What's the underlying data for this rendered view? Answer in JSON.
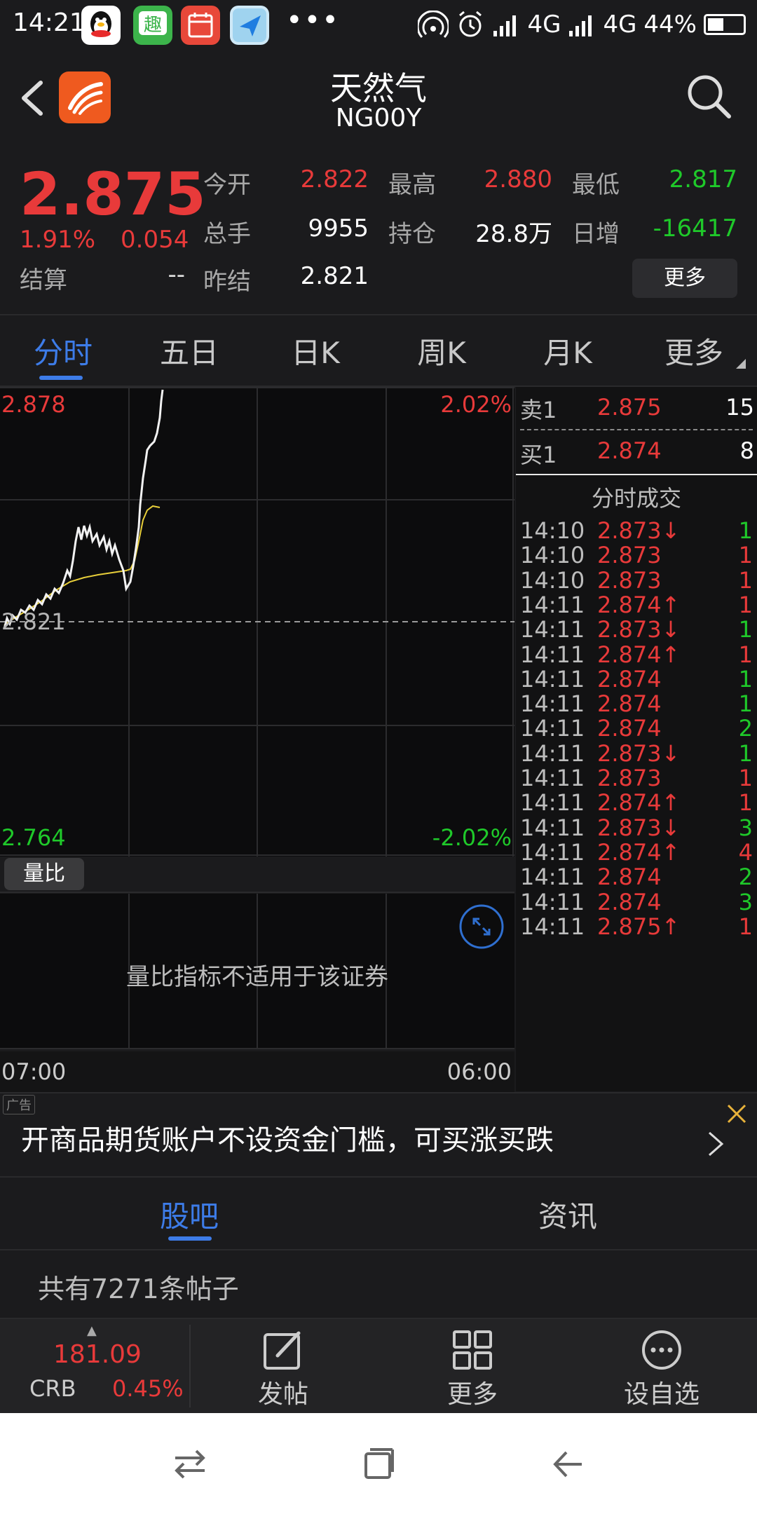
{
  "status": {
    "time": "14:21",
    "network1": "4G",
    "network2": "4G",
    "battery": "44%"
  },
  "header": {
    "title": "天然气",
    "code": "NG00Y"
  },
  "quote": {
    "price": "2.875",
    "pct": "1.91%",
    "change": "0.054",
    "settle_label": "结算",
    "settle_value": "--",
    "open_label": "今开",
    "open_value": "2.822",
    "high_label": "最高",
    "high_value": "2.880",
    "low_label": "最低",
    "low_value": "2.817",
    "volume_label": "总手",
    "volume_value": "9955",
    "oi_label": "持仓",
    "oi_value": "28.8万",
    "daily_inc_label": "日增",
    "daily_inc_value": "-16417",
    "prev_settle_label": "昨结",
    "prev_settle_value": "2.821",
    "more_label": "更多"
  },
  "tabs": [
    "分时",
    "五日",
    "日K",
    "周K",
    "月K",
    "更多"
  ],
  "chart": {
    "top_price": "2.878",
    "top_pct": "2.02%",
    "bottom_price": "2.764",
    "bottom_pct": "-2.02%",
    "ref_price": "2.821",
    "start_time": "07:00",
    "end_time": "06:00",
    "volratio_label": "量比",
    "volratio_msg": "量比指标不适用于该证券"
  },
  "book": {
    "sell_label": "卖1",
    "sell_price": "2.875",
    "sell_qty": "15",
    "buy_label": "买1",
    "buy_price": "2.874",
    "buy_qty": "8",
    "trades_title": "分时成交",
    "trades": [
      {
        "time": "14:10",
        "price": "2.873↓",
        "qty": "1",
        "dir": "down"
      },
      {
        "time": "14:10",
        "price": "2.873",
        "qty": "1",
        "dir": "up"
      },
      {
        "time": "14:10",
        "price": "2.873",
        "qty": "1",
        "dir": "up"
      },
      {
        "time": "14:11",
        "price": "2.874↑",
        "qty": "1",
        "dir": "up"
      },
      {
        "time": "14:11",
        "price": "2.873↓",
        "qty": "1",
        "dir": "down"
      },
      {
        "time": "14:11",
        "price": "2.874↑",
        "qty": "1",
        "dir": "up"
      },
      {
        "time": "14:11",
        "price": "2.874",
        "qty": "1",
        "dir": "down"
      },
      {
        "time": "14:11",
        "price": "2.874",
        "qty": "1",
        "dir": "down"
      },
      {
        "time": "14:11",
        "price": "2.874",
        "qty": "2",
        "dir": "down"
      },
      {
        "time": "14:11",
        "price": "2.873↓",
        "qty": "1",
        "dir": "down"
      },
      {
        "time": "14:11",
        "price": "2.873",
        "qty": "1",
        "dir": "up"
      },
      {
        "time": "14:11",
        "price": "2.874↑",
        "qty": "1",
        "dir": "up"
      },
      {
        "time": "14:11",
        "price": "2.873↓",
        "qty": "3",
        "dir": "down"
      },
      {
        "time": "14:11",
        "price": "2.874↑",
        "qty": "4",
        "dir": "up"
      },
      {
        "time": "14:11",
        "price": "2.874",
        "qty": "2",
        "dir": "down"
      },
      {
        "time": "14:11",
        "price": "2.874",
        "qty": "3",
        "dir": "down"
      },
      {
        "time": "14:11",
        "price": "2.875↑",
        "qty": "1",
        "dir": "up"
      }
    ]
  },
  "ad": {
    "tag": "广告",
    "text": "开商品期货账户不设资金门槛，可买涨买跌"
  },
  "section_tabs": [
    "股吧",
    "资讯"
  ],
  "posts": {
    "text": "共有7271条帖子"
  },
  "toolbar": {
    "crb_value": "181.09",
    "crb_name": "CRB",
    "crb_pct": "0.45%",
    "post_label": "发帖",
    "more_label": "更多",
    "watch_label": "设自选"
  },
  "colors": {
    "up": "#e83a3a",
    "down": "#1fc92a",
    "accent": "#3d7ce8",
    "brand": "#ef5a1f"
  }
}
